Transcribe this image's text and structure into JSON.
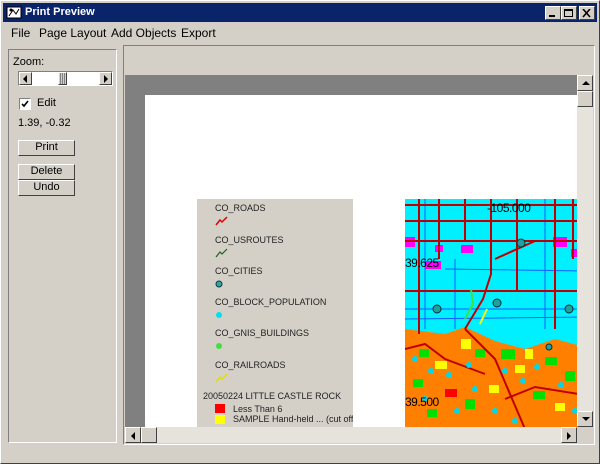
{
  "window": {
    "title": "Print Preview"
  },
  "menu": {
    "file": "File",
    "page_layout": "Page Layout",
    "add_objects": "Add Objects",
    "export": "Export"
  },
  "panel": {
    "zoom_label": "Zoom:",
    "zoom_level": 0.45,
    "edit_label": "Edit",
    "edit_checked": true,
    "coords": "1.39, -0.32",
    "print_label": "Print",
    "delete_label": "Delete",
    "undo_label": "Undo"
  },
  "legend": {
    "items": [
      {
        "label": "CO_ROADS",
        "symbol": "red-line-icon"
      },
      {
        "label": "CO_USROUTES",
        "symbol": "green-line-icon"
      },
      {
        "label": "CO_CITIES",
        "symbol": "teal-dot-icon"
      },
      {
        "label": "CO_BLOCK_POPULATION",
        "symbol": "cyan-dot-icon"
      },
      {
        "label": "CO_GNIS_BUILDINGS",
        "symbol": "green-dot-icon"
      },
      {
        "label": "CO_RAILROADS",
        "symbol": "yellow-line-icon"
      }
    ],
    "raster_title": "20050224 LITTLE CASTLE ROCK",
    "raster_classes": [
      {
        "label": "Less Than 6",
        "color": "#ff0000"
      },
      {
        "label": "SAMPLE Hand-held ... (cut off)",
        "color": "#ffff00"
      }
    ]
  },
  "map": {
    "labels": [
      "-105.000",
      "39.625",
      "39.500"
    ],
    "colors": {
      "water": "#00f0ff",
      "roads": "#c00000",
      "orange": "#ff8000",
      "magenta": "#ff00ff",
      "green": "#00e000",
      "yellow": "#ffff00"
    }
  },
  "colors": {
    "titlebar": "#0a246a",
    "face": "#d4d0c8"
  }
}
